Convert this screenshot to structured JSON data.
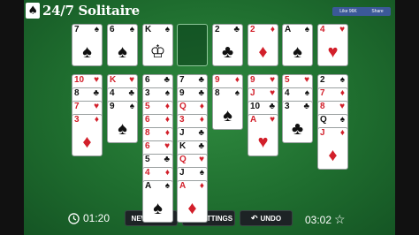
{
  "app": {
    "logo_mark": "♠",
    "logo_text": "24/7 Solitaire",
    "fb_like": "Like 96K",
    "fb_share": "Share"
  },
  "tableau_top": [
    {
      "rank": "7",
      "suit": "♠",
      "color": "black"
    },
    {
      "rank": "6",
      "suit": "♠",
      "color": "black"
    },
    {
      "rank": "K",
      "suit": "♠",
      "color": "black",
      "face": "♔"
    },
    null,
    {
      "rank": "2",
      "suit": "♣",
      "color": "black"
    },
    {
      "rank": "2",
      "suit": "♦",
      "color": "red"
    },
    {
      "rank": "A",
      "suit": "♠",
      "color": "black"
    },
    {
      "rank": "4",
      "suit": "♥",
      "color": "red"
    }
  ],
  "tableau_bottom": [
    [
      {
        "rank": "10",
        "suit": "♥",
        "color": "red"
      },
      {
        "rank": "8",
        "suit": "♣",
        "color": "black"
      },
      {
        "rank": "7",
        "suit": "♥",
        "color": "red"
      },
      {
        "rank": "3",
        "suit": "♦",
        "color": "red"
      }
    ],
    [
      {
        "rank": "K",
        "suit": "♥",
        "color": "red"
      },
      {
        "rank": "4",
        "suit": "♣",
        "color": "black"
      },
      {
        "rank": "9",
        "suit": "♠",
        "color": "black"
      }
    ],
    [
      {
        "rank": "6",
        "suit": "♣",
        "color": "black"
      },
      {
        "rank": "3",
        "suit": "♠",
        "color": "black"
      },
      {
        "rank": "5",
        "suit": "♦",
        "color": "red"
      },
      {
        "rank": "6",
        "suit": "♦",
        "color": "red"
      },
      {
        "rank": "8",
        "suit": "♦",
        "color": "red"
      },
      {
        "rank": "6",
        "suit": "♥",
        "color": "red"
      },
      {
        "rank": "5",
        "suit": "♣",
        "color": "black"
      },
      {
        "rank": "4",
        "suit": "♦",
        "color": "red"
      },
      {
        "rank": "A",
        "suit": "♠",
        "color": "black"
      }
    ],
    [
      {
        "rank": "7",
        "suit": "♣",
        "color": "black"
      },
      {
        "rank": "9",
        "suit": "♣",
        "color": "black"
      },
      {
        "rank": "Q",
        "suit": "♦",
        "color": "red"
      },
      {
        "rank": "3",
        "suit": "♦",
        "color": "red"
      },
      {
        "rank": "J",
        "suit": "♣",
        "color": "black"
      },
      {
        "rank": "K",
        "suit": "♣",
        "color": "black"
      },
      {
        "rank": "Q",
        "suit": "♥",
        "color": "red"
      },
      {
        "rank": "J",
        "suit": "♠",
        "color": "black"
      },
      {
        "rank": "A",
        "suit": "♦",
        "color": "red"
      }
    ],
    [
      {
        "rank": "9",
        "suit": "♦",
        "color": "red"
      },
      {
        "rank": "8",
        "suit": "♠",
        "color": "black"
      }
    ],
    [
      {
        "rank": "9",
        "suit": "♥",
        "color": "red"
      },
      {
        "rank": "J",
        "suit": "♥",
        "color": "red"
      },
      {
        "rank": "10",
        "suit": "♣",
        "color": "black"
      },
      {
        "rank": "A",
        "suit": "♥",
        "color": "red"
      }
    ],
    [
      {
        "rank": "5",
        "suit": "♥",
        "color": "red"
      },
      {
        "rank": "4",
        "suit": "♠",
        "color": "black"
      },
      {
        "rank": "3",
        "suit": "♣",
        "color": "black"
      }
    ],
    [
      {
        "rank": "2",
        "suit": "♠",
        "color": "black"
      },
      {
        "rank": "7",
        "suit": "♦",
        "color": "red"
      },
      {
        "rank": "8",
        "suit": "♥",
        "color": "red"
      },
      {
        "rank": "Q",
        "suit": "♠",
        "color": "black"
      },
      {
        "rank": "J",
        "suit": "♦",
        "color": "red"
      }
    ]
  ],
  "footer": {
    "elapsed_time": "01:20",
    "clock_icon": "clock-icon",
    "new_game": "NEW GAME",
    "settings_icon": "🔧",
    "settings": "SETTINGS",
    "undo_icon": "↶",
    "undo": "UNDO",
    "score_time": "03:02",
    "star_icon": "☆"
  },
  "colors": {
    "felt": "#1f6e2f",
    "red_suit": "#d21f2a",
    "black_suit": "#111111",
    "button": "#1d2325"
  }
}
